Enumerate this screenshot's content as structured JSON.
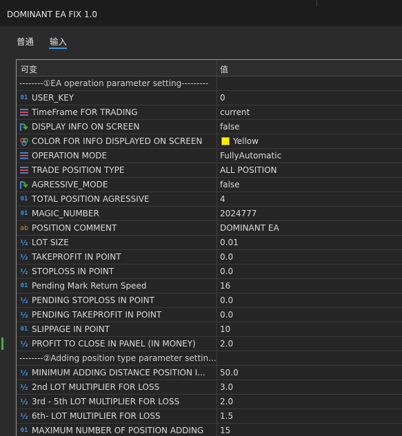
{
  "window": {
    "title": "DOMINANT EA FIX 1.0"
  },
  "tabs": [
    {
      "label": "普通"
    },
    {
      "label": "输入"
    }
  ],
  "active_tab": 1,
  "table": {
    "columns": {
      "name": "可变",
      "value": "值"
    },
    "rows": [
      {
        "type": "separator",
        "name": "--------①EA operation parameter setting---------",
        "value": ""
      },
      {
        "type": "int",
        "icon": "integer-icon",
        "name": "USER_KEY",
        "value": "0"
      },
      {
        "type": "enum",
        "icon": "enum-icon",
        "name": "TimeFrame FOR TRADING",
        "value": "current"
      },
      {
        "type": "bool",
        "icon": "bool-icon",
        "name": "DISPLAY INFO ON SCREEN",
        "value": "false"
      },
      {
        "type": "color",
        "icon": "color-icon",
        "name": "COLOR FOR INFO DISPLAYED ON SCREEN",
        "value": "Yellow",
        "swatch": "#ffee00"
      },
      {
        "type": "enum",
        "icon": "enum-icon",
        "name": "OPERATION MODE",
        "value": "FullyAutomatic"
      },
      {
        "type": "enum",
        "icon": "enum-icon",
        "name": "TRADE POSITION TYPE",
        "value": "ALL POSITION"
      },
      {
        "type": "bool",
        "icon": "bool-icon",
        "name": "AGRESSIVE_MODE",
        "value": "false"
      },
      {
        "type": "int",
        "icon": "integer-icon",
        "name": "TOTAL POSITION AGRESSIVE",
        "value": "4"
      },
      {
        "type": "int",
        "icon": "integer-icon",
        "name": "MAGIC_NUMBER",
        "value": "2024777"
      },
      {
        "type": "str",
        "icon": "string-icon",
        "name": "POSITION COMMENT",
        "value": "DOMINANT EA"
      },
      {
        "type": "dbl",
        "icon": "double-icon",
        "name": "LOT SIZE",
        "value": "0.01"
      },
      {
        "type": "dbl",
        "icon": "double-icon",
        "name": "TAKEPROFIT IN POINT",
        "value": "0.0"
      },
      {
        "type": "dbl",
        "icon": "double-icon",
        "name": "STOPLOSS IN POINT",
        "value": "0.0"
      },
      {
        "type": "int",
        "icon": "integer-icon",
        "name": "Pending Mark Return Speed",
        "value": "16"
      },
      {
        "type": "dbl",
        "icon": "double-icon",
        "name": "PENDING STOPLOSS IN POINT",
        "value": "0.0"
      },
      {
        "type": "dbl",
        "icon": "double-icon",
        "name": "PENDING TAKEPROFIT IN POINT",
        "value": "0.0"
      },
      {
        "type": "int",
        "icon": "integer-icon",
        "name": "SLIPPAGE IN POINT",
        "value": "10"
      },
      {
        "type": "dbl",
        "icon": "double-icon",
        "name": "PROFIT TO CLOSE IN PANEL (IN MONEY)",
        "value": "2.0"
      },
      {
        "type": "separator",
        "name": "--------②Adding position type parameter settin...",
        "value": ""
      },
      {
        "type": "dbl",
        "icon": "double-icon",
        "name": "MINIMUM ADDING DISTANCE POSITION I...",
        "value": "50.0"
      },
      {
        "type": "dbl",
        "icon": "double-icon",
        "name": "2nd LOT MULTIPLIER FOR  LOSS",
        "value": "3.0"
      },
      {
        "type": "dbl",
        "icon": "double-icon",
        "name": "3rd - 5th LOT MULTIPLIER FOR  LOSS",
        "value": "2.0"
      },
      {
        "type": "dbl",
        "icon": "double-icon",
        "name": "6th- LOT MULTIPLIER FOR  LOSS",
        "value": "1.5"
      },
      {
        "type": "int",
        "icon": "integer-icon",
        "name": "MAXIMUM NUMBER OF POSITION ADDING",
        "value": "15"
      }
    ]
  }
}
